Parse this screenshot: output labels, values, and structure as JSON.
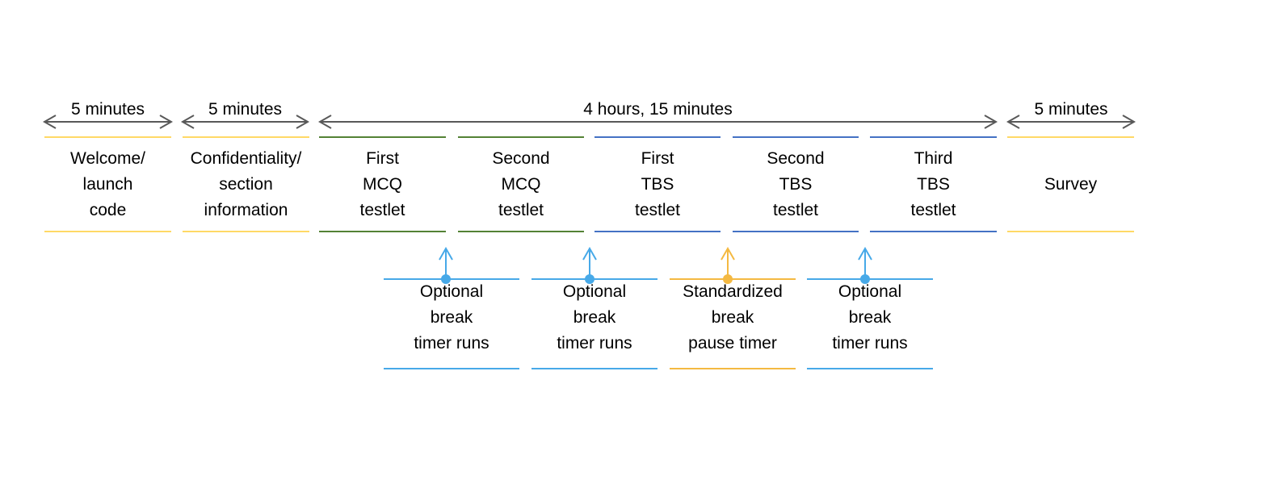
{
  "colors": {
    "arrow": "#595959",
    "yellow": "#ffd966",
    "green": "#548235",
    "blue": "#4472c4",
    "light_blue": "#47a9e8",
    "orange": "#f4b942"
  },
  "durations": [
    {
      "label": "5 minutes",
      "span": "welcome"
    },
    {
      "label": "5 minutes",
      "span": "confidentiality"
    },
    {
      "label": "4 hours, 15 minutes",
      "span": "testlets"
    },
    {
      "label": "5 minutes",
      "span": "survey"
    }
  ],
  "sections": [
    {
      "label": "Welcome/\nlaunch\ncode",
      "color": "yellow"
    },
    {
      "label": "Confidentiality/\nsection\ninformation",
      "color": "yellow"
    },
    {
      "label": "First\nMCQ\ntestlet",
      "color": "green"
    },
    {
      "label": "Second\nMCQ\ntestlet",
      "color": "green"
    },
    {
      "label": "First\nTBS\ntestlet",
      "color": "blue"
    },
    {
      "label": "Second\nTBS\ntestlet",
      "color": "blue"
    },
    {
      "label": "Third\nTBS\ntestlet",
      "color": "blue"
    },
    {
      "label": "Survey",
      "color": "yellow"
    }
  ],
  "breaks": [
    {
      "label": "Optional\nbreak\ntimer runs",
      "color": "light_blue"
    },
    {
      "label": "Optional\nbreak\ntimer runs",
      "color": "light_blue"
    },
    {
      "label": "Standardized\nbreak\npause timer",
      "color": "orange"
    },
    {
      "label": "Optional\nbreak\ntimer runs",
      "color": "light_blue"
    }
  ]
}
